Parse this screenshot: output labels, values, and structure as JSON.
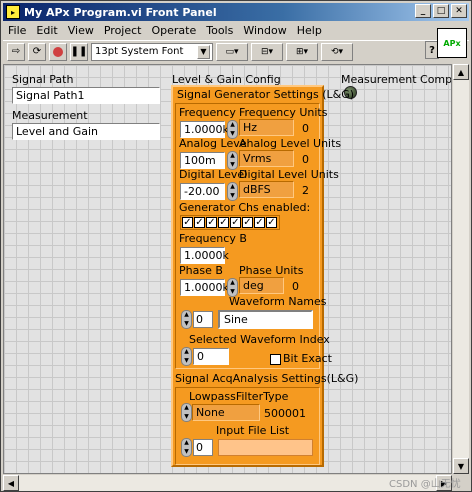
{
  "window": {
    "title": "My APx Program.vi Front Panel",
    "vi_icon_text": "APx"
  },
  "menu": [
    "File",
    "Edit",
    "View",
    "Project",
    "Operate",
    "Tools",
    "Window",
    "Help"
  ],
  "toolbar": {
    "font": "13pt System Font",
    "help": "?"
  },
  "controls": {
    "signal_path": {
      "label": "Signal Path",
      "value": "Signal Path1"
    },
    "measurement": {
      "label": "Measurement",
      "value": "Level and Gain"
    },
    "config_label": "Level & Gain Config",
    "complete": {
      "label": "Measurement Complete",
      "state": "off"
    }
  },
  "gen": {
    "title": "Signal Generator Settings (L&G)",
    "frequency": {
      "label": "Frequency",
      "value": "1.0000k"
    },
    "frequency_units": {
      "label": "Frequency Units",
      "value": "Hz",
      "index": "0"
    },
    "analog_level": {
      "label": "Analog Level",
      "value": "100m"
    },
    "analog_units": {
      "label": "Analog Level Units",
      "value": "Vrms",
      "index": "0"
    },
    "digital_level": {
      "label": "Digital Level",
      "value": "-20.00"
    },
    "digital_units": {
      "label": "Digital Level Units",
      "value": "dBFS",
      "index": "2"
    },
    "chs_label": "Generator Chs enabled:",
    "chs_checked": [
      true,
      true,
      true,
      true,
      true,
      true,
      true,
      true
    ],
    "frequency_b": {
      "label": "Frequency B",
      "value": "1.0000k"
    },
    "phase_b": {
      "label": "Phase B",
      "value": "1.0000k"
    },
    "phase_units": {
      "label": "Phase Units",
      "value": "deg",
      "index": "0"
    },
    "waveform_names": {
      "label": "Waveform Names",
      "index": "0",
      "value": "Sine"
    },
    "selected_waveform": {
      "label": "Selected Waveform Index",
      "value": "0"
    },
    "bit_exact": {
      "label": "Bit Exact",
      "checked": false
    }
  },
  "acq": {
    "title": "Signal AcqAnalysis Settings(L&G)",
    "lowpass": {
      "label": "LowpassFilterType",
      "value": "None",
      "index": "500001"
    },
    "input_files": {
      "label": "Input File List",
      "index": "0",
      "value": ""
    }
  },
  "watermark": "CSDN @山无忧"
}
